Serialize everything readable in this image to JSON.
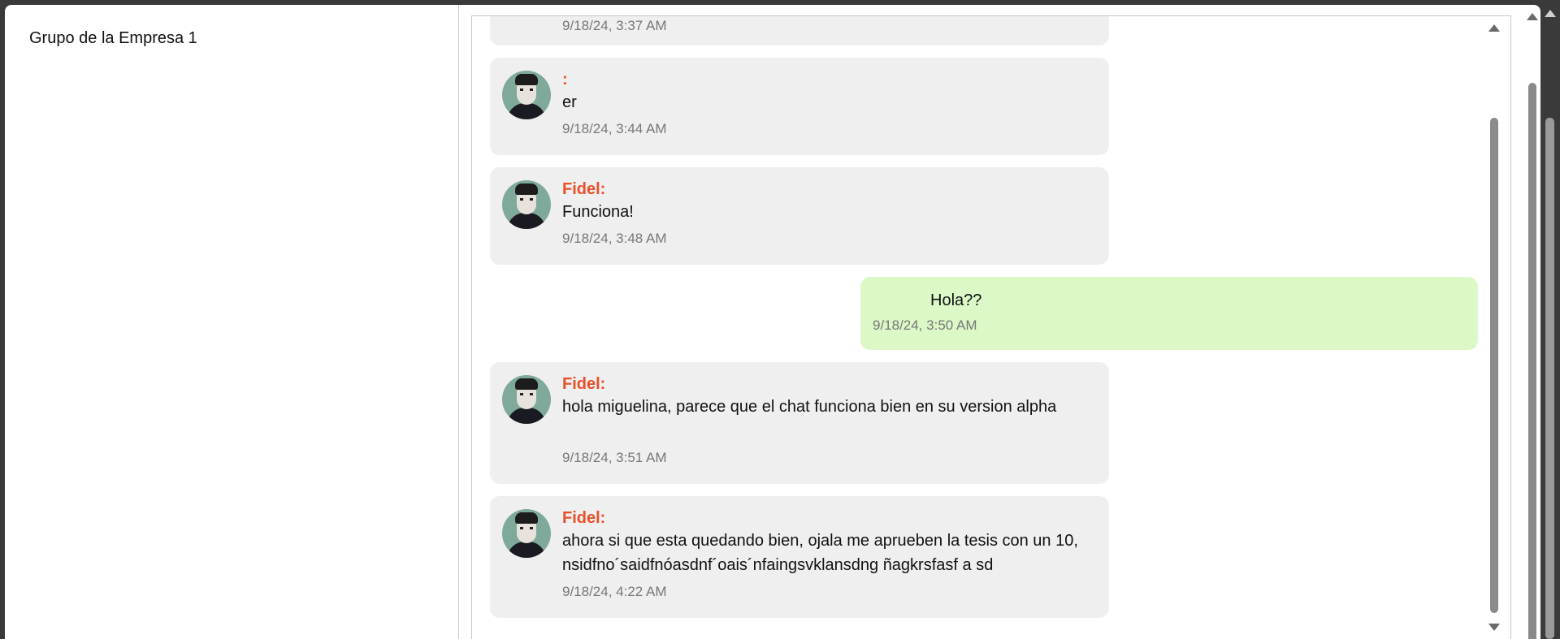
{
  "group": {
    "title": "Grupo de la Empresa 1"
  },
  "messages": [
    {
      "sender": "",
      "text": "",
      "time": "9/18/24, 3:37 AM",
      "own": false
    },
    {
      "sender": ":",
      "text": "er",
      "time": "9/18/24, 3:44 AM",
      "own": false
    },
    {
      "sender": "Fidel:",
      "text": "Funciona!",
      "time": "9/18/24, 3:48 AM",
      "own": false
    },
    {
      "sender": "",
      "text": "Hola??",
      "time": "9/18/24, 3:50 AM",
      "own": true
    },
    {
      "sender": "Fidel:",
      "text": "hola miguelina, parece que el chat funciona bien en su version alpha",
      "time": "9/18/24, 3:51 AM",
      "own": false
    },
    {
      "sender": "Fidel:",
      "text": "ahora si que esta quedando bien, ojala me aprueben la tesis con un 10, nsidfno´saidfnóasdnf´oais´nfaingsvklansdng ñagkrsfasf a sd",
      "time": "9/18/24, 4:22 AM",
      "own": false
    }
  ],
  "colors": {
    "sender": "#e8502a",
    "own_bubble": "#dcf8c6",
    "other_bubble": "#efefef"
  },
  "icons": {
    "avatar": "user-avatar-photo",
    "scroll_up": "triangle-up",
    "scroll_down": "triangle-down"
  }
}
